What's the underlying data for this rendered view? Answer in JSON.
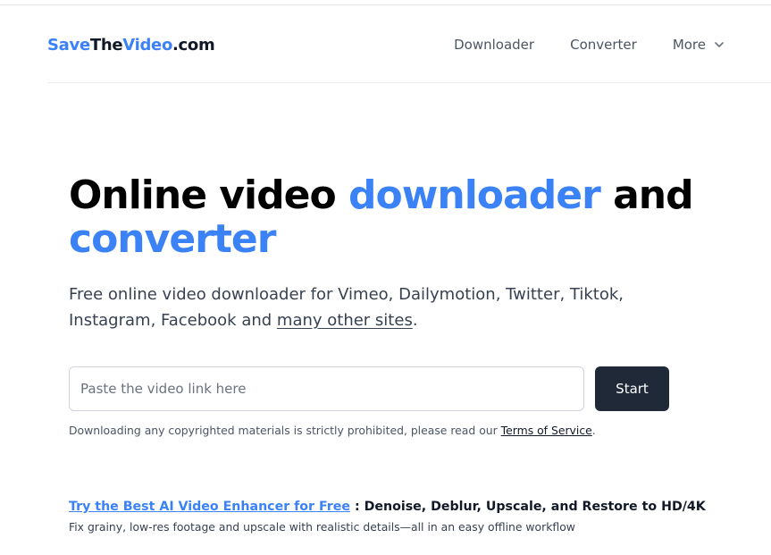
{
  "header": {
    "logo": {
      "part1": "Save",
      "part2": "The",
      "part3": "Video",
      "part4": ".com"
    },
    "nav": [
      {
        "label": "Downloader"
      },
      {
        "label": "Converter"
      },
      {
        "label": "More"
      }
    ]
  },
  "hero": {
    "title_part1": "Online video ",
    "title_accent1": "downloader",
    "title_part2": " and",
    "title_accent2": "converter",
    "subtitle_text": "Free online video downloader for Vimeo, Dailymotion, Twitter, Tiktok, Instagram, Facebook and ",
    "subtitle_link": "many other sites",
    "subtitle_end": "."
  },
  "form": {
    "placeholder": "Paste the video link here",
    "value": "",
    "start_label": "Start",
    "disclaimer_text": "Downloading any copyrighted materials is strictly prohibited, please read our ",
    "disclaimer_link": "Terms of Service",
    "disclaimer_end": "."
  },
  "promo": {
    "link": "Try the Best AI Video Enhancer for Free",
    "text": " : Denoise, Deblur, Upscale, and Restore to HD/4K",
    "description": "Fix grainy, low-res footage and upscale with realistic details—all in an easy offline workflow"
  },
  "colors": {
    "accent": "#3b82f6",
    "button": "#1f2937"
  }
}
